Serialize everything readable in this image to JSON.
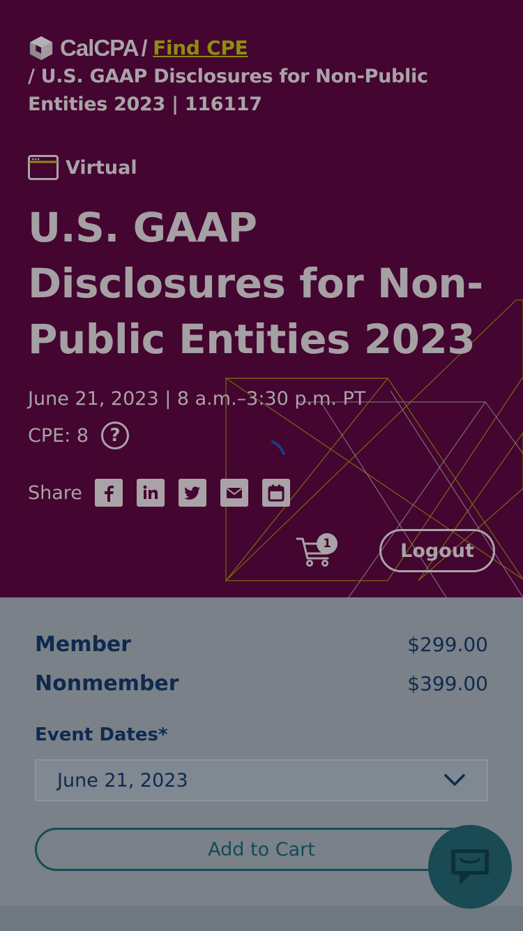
{
  "breadcrumb": {
    "logo_text": "CalCPA",
    "separator": "/",
    "link_label": "Find CPE",
    "rest": "/ U.S. GAAP Disclosures for Non-Public Entities 2023 | 116117"
  },
  "event": {
    "format_label": "Virtual",
    "title": "U.S. GAAP Disclosures for Non-Public Entities 2023",
    "date_time": "June 21, 2023 | 8 a.m.–3:30 p.m. PT",
    "cpe": "CPE: 8",
    "help_glyph": "?"
  },
  "share": {
    "label": "Share",
    "icons": [
      "facebook-icon",
      "linkedin-icon",
      "twitter-icon",
      "email-icon",
      "calendar-icon"
    ]
  },
  "cart": {
    "count": "1"
  },
  "logout_label": "Logout",
  "pricing": {
    "member_label": "Member",
    "member_price": "$299.00",
    "nonmember_label": "Nonmember",
    "nonmember_price": "$399.00"
  },
  "event_dates": {
    "label": "Event Dates*",
    "selected": "June 21, 2023"
  },
  "add_to_cart_label": "Add to Cart",
  "colors": {
    "hero_bg": "#440530",
    "link": "#8d8d10",
    "navy": "#0e2a4e",
    "teal": "#124c56"
  }
}
